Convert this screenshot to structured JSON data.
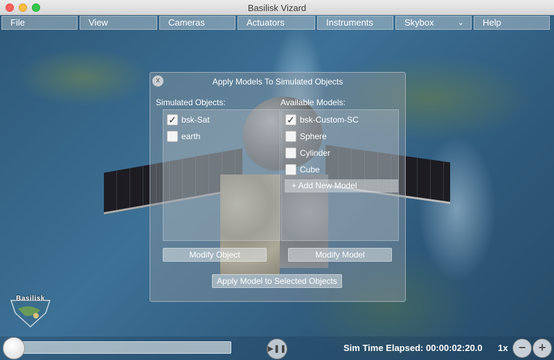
{
  "window": {
    "title": "Basilisk Vizard"
  },
  "menubar": {
    "items": [
      "File",
      "View",
      "Cameras",
      "Actuators",
      "Instruments",
      "Skybox",
      "Help"
    ]
  },
  "dialog": {
    "close_glyph": "x",
    "title": "Apply Models To Simulated Objects",
    "simulated_objects_label": "Simulated Objects:",
    "available_models_label": "Available Models:",
    "simulated_objects": [
      {
        "label": "bsk-Sat",
        "checked": true
      },
      {
        "label": "earth",
        "checked": false
      }
    ],
    "available_models": [
      {
        "label": "bsk-Custom-SC",
        "checked": true
      },
      {
        "label": "Sphere",
        "checked": false
      },
      {
        "label": "Cylinder",
        "checked": false
      },
      {
        "label": "Cube",
        "checked": false
      }
    ],
    "add_new_model": "+ Add New Model",
    "modify_object": "Modify Object",
    "modify_model": "Modify Model",
    "apply_button": "Apply Model to Selected Objects"
  },
  "logo": {
    "text": "Basilisk"
  },
  "playback": {
    "sim_time": "Sim Time Elapsed: 00:00:02:20.0",
    "speed": "1x",
    "minus_glyph": "−",
    "plus_glyph": "+"
  }
}
